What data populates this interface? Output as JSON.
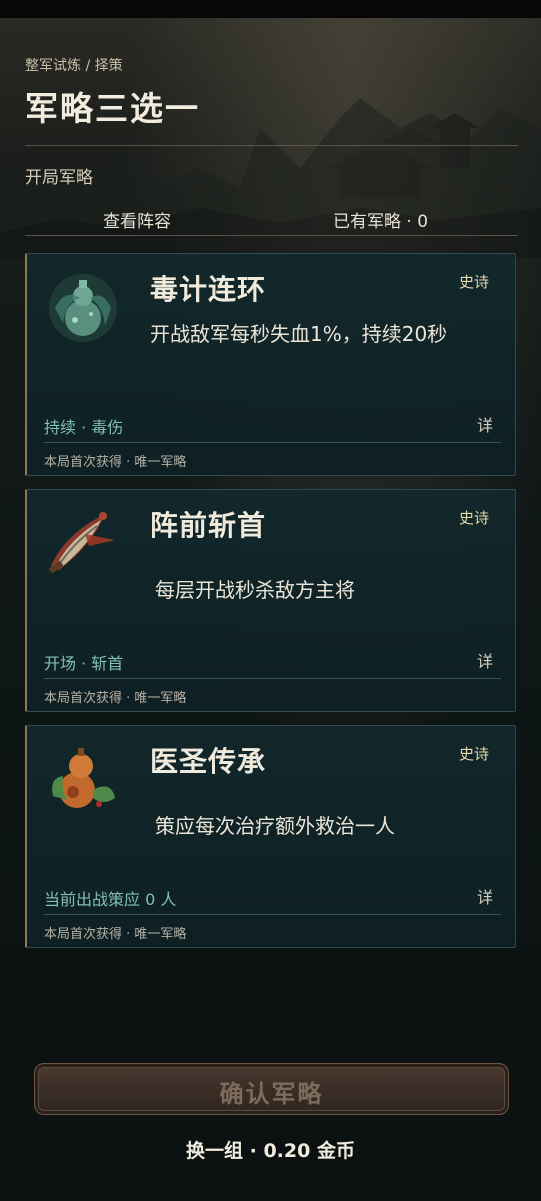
{
  "header": {
    "breadcrumb": "整军试炼 / 择策",
    "title": "军略三选一",
    "subtitle": "开局军略"
  },
  "tabs": {
    "view_team": "查看阵容",
    "owned": "已有军略 · 0"
  },
  "cards": [
    {
      "name": "毒计连环",
      "rarity": "史诗",
      "desc": "开战敌军每秒失血1%，持续20秒",
      "tags": "持续 · 毒伤",
      "detail": "详",
      "note": "本局首次获得 · 唯一军略",
      "icon": "poison-gourd-icon"
    },
    {
      "name": "阵前斩首",
      "rarity": "史诗",
      "desc": "每层开战秒杀敌方主将",
      "tags": "开场 · 斩首",
      "detail": "详",
      "note": "本局首次获得 · 唯一军略",
      "icon": "blade-icon"
    },
    {
      "name": "医圣传承",
      "rarity": "史诗",
      "desc": "策应每次治疗额外救治一人",
      "tags": "当前出战策应 0 人",
      "detail": "详",
      "note": "本局首次获得 · 唯一军略",
      "icon": "medicine-gourd-icon"
    }
  ],
  "footer": {
    "confirm": "确认军略",
    "reroll": "换一组 · 0.20 金币"
  },
  "colors": {
    "accent_gold": "#8a7a4f",
    "tag_teal": "#7fc0b0",
    "card_bg": "#12282c"
  }
}
